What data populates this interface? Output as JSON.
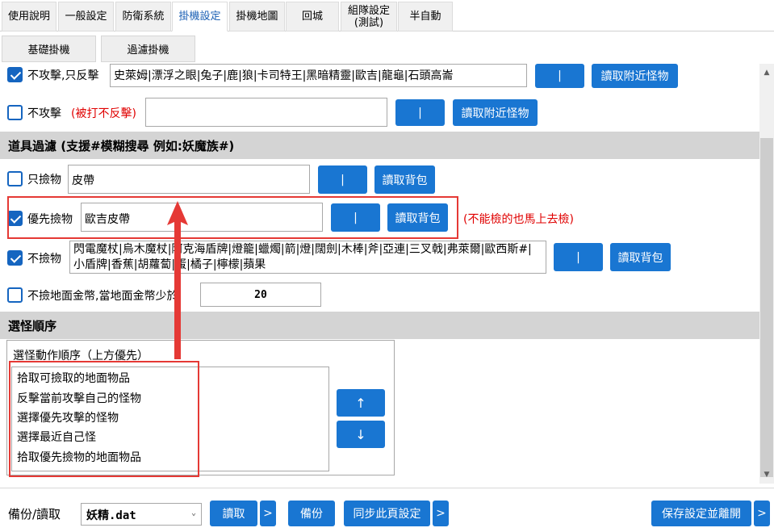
{
  "tabs": [
    {
      "label": "使用說明",
      "active": false
    },
    {
      "label": "一般設定",
      "active": false
    },
    {
      "label": "防衛系統",
      "active": false
    },
    {
      "label": "掛機設定",
      "active": true
    },
    {
      "label": "掛機地圖",
      "active": false
    },
    {
      "label": "回城",
      "active": false
    },
    {
      "label": "組隊設定\n(測試)",
      "active": false
    },
    {
      "label": "半自動",
      "active": false
    }
  ],
  "subtabs": [
    "基礎掛機",
    "過濾掛機"
  ],
  "attack": {
    "no_attack_counter": {
      "checked": true,
      "label": "不攻擊,只反擊",
      "value": "史萊姆|漂浮之眼|兔子|鹿|狼|卡司特王|黑暗精靈|歐吉|龍龜|石頭高崙",
      "pipe_button": "|",
      "read_button": "讀取附近怪物"
    },
    "no_attack": {
      "checked": false,
      "label": "不攻擊",
      "note": "(被打不反擊)",
      "value": "",
      "pipe_button": "|",
      "read_button": "讀取附近怪物"
    }
  },
  "item_filter": {
    "section_title": "道具過濾 (支援#模糊搜尋 例如:妖魔族#)",
    "pickup_only": {
      "checked": false,
      "label": "只撿物",
      "value": "皮帶",
      "pipe_button": "|",
      "read_button": "讀取背包"
    },
    "priority_pickup": {
      "checked": true,
      "label": "優先撿物",
      "value": "歐吉皮帶",
      "pipe_button": "|",
      "read_button": "讀取背包",
      "annotation": "(不能檢的也馬上去檢)"
    },
    "no_pickup": {
      "checked": true,
      "label": "不撿物",
      "value": "閃電魔杖|烏木魔杖|阿克海盾牌|燈籠|蠟燭|箭|燈|闊劍|木棒|斧|亞連|三叉戟|弗萊爾|歐西斯#|小盾牌|香蕉|胡蘿蔔|蛋|橘子|檸檬|蘋果",
      "pipe_button": "|",
      "read_button": "讀取背包"
    },
    "no_coins": {
      "checked": false,
      "label": "不撿地面金幣,當地面金幣少於",
      "value": "20"
    }
  },
  "target_order": {
    "section_title": "選怪順序",
    "group_title": "選怪動作順序（上方優先）",
    "items": [
      "拾取可撿取的地面物品",
      "反擊當前攻擊自己的怪物",
      "選擇優先攻擊的怪物",
      "選擇最近自己怪",
      "拾取優先撿物的地面物品"
    ],
    "up_button": "↑",
    "down_button": "↓"
  },
  "footer": {
    "backup_label": "備份/讀取",
    "file_select": "妖精.dat",
    "read_button": "讀取",
    "more": ">",
    "backup_button": "備份",
    "sync_button": "同步此頁設定",
    "save_button": "保存設定並離開"
  },
  "colors": {
    "accent": "#1976d2",
    "highlight": "#e53935"
  }
}
